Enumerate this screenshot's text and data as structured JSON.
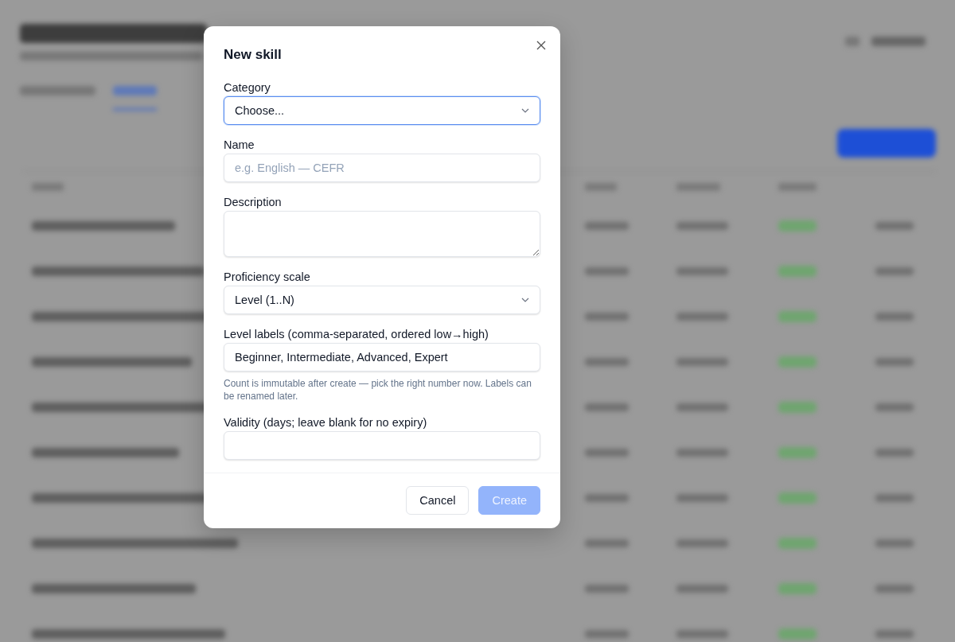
{
  "dialog": {
    "title": "New skill",
    "fields": [
      {
        "kind": "select",
        "label": "Category",
        "value": "Choose...",
        "focused": true
      },
      {
        "kind": "input",
        "label": "Name",
        "placeholder": "e.g. English — CEFR",
        "focused": false
      },
      {
        "kind": "textarea",
        "label": "Description",
        "focused": false
      },
      {
        "kind": "select",
        "label": "Proficiency scale",
        "value": "Level (1..N)",
        "focused": false
      },
      {
        "kind": "input",
        "label": "Level labels (comma-separated, ordered low→high)",
        "value": "Beginner, Intermediate, Advanced, Expert",
        "hint": "Count is immutable after create — pick the right number now. Labels can be renamed later.",
        "focused": false
      },
      {
        "kind": "input",
        "label": "Validity (days; leave blank for no expiry)",
        "focused": false
      }
    ],
    "buttons": [
      {
        "label": "Cancel",
        "kind": "secondary",
        "disabled": false
      },
      {
        "label": "Create",
        "kind": "primary",
        "disabled": true
      }
    ]
  }
}
